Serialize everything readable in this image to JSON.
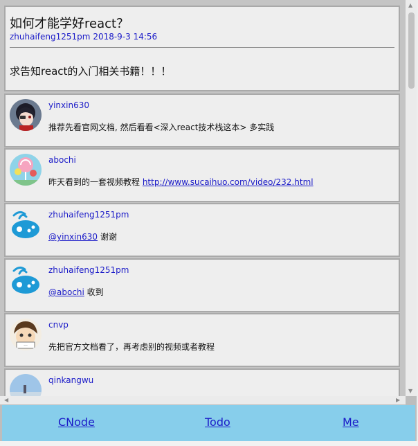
{
  "topic": {
    "title": "如何才能学好react？",
    "author": "zhuhaifeng1251pm",
    "date": "2018-9-3 14:56",
    "body": "求告知react的入门相关书籍！！！"
  },
  "replies": [
    {
      "author": "yinxin630",
      "avatar_icon": "anime-girl-avatar",
      "text": "推荐先看官网文档, 然后看看<深入react技术栈这本> 多实践"
    },
    {
      "author": "abochi",
      "avatar_icon": "lollipop-avatar",
      "text_before": "昨天看到的一套视频教程 ",
      "link": "http://www.sucaihuo.com/video/232.html"
    },
    {
      "author": "zhuhaifeng1251pm",
      "avatar_icon": "gamepad-avatar",
      "mention": "@yinxin630",
      "text_after": " 谢谢"
    },
    {
      "author": "zhuhaifeng1251pm",
      "avatar_icon": "gamepad-avatar",
      "mention": "@abochi",
      "text_after": " 收到"
    },
    {
      "author": "cnvp",
      "avatar_icon": "cartoon-child-avatar",
      "text": "先把官方文档看了，再考虑别的视频或者教程"
    },
    {
      "author": "qinkangwu",
      "avatar_icon": "landscape-avatar",
      "text": ""
    }
  ],
  "tabs": {
    "cnode": "CNode",
    "todo": "Todo",
    "me": "Me"
  },
  "colors": {
    "link": "#1a1ac8",
    "tabbar": "#87ceeb",
    "card": "#eeeeee",
    "gamepad": "#1e9ad6"
  }
}
